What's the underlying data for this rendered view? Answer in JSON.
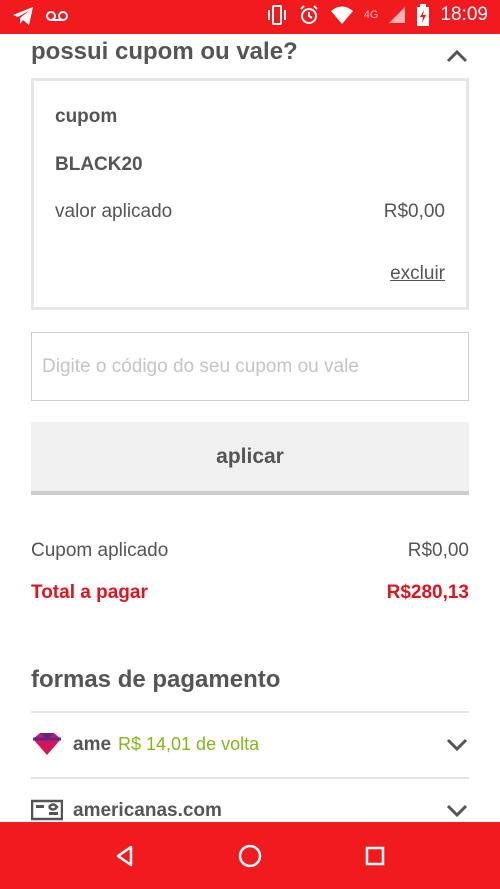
{
  "status_bar": {
    "network": "4G",
    "time": "18:09",
    "icons": [
      "telegram-icon",
      "voicemail-icon",
      "vibrate-icon",
      "alarm-icon",
      "wifi-icon",
      "signal-icon",
      "battery-charging-icon"
    ]
  },
  "coupon": {
    "title": "possui cupom ou vale?",
    "box_label": "cupom",
    "code": "BLACK20",
    "applied_label": "valor aplicado",
    "applied_value": "R$0,00",
    "remove_label": "excluir",
    "input_placeholder": "Digite o código do seu cupom ou vale",
    "input_value": "",
    "apply_label": "aplicar"
  },
  "summary": {
    "coupon_label": "Cupom aplicado",
    "coupon_value": "R$0,00",
    "total_label": "Total a pagar",
    "total_value": "R$280,13"
  },
  "payments": {
    "title": "formas de pagamento",
    "items": [
      {
        "name": "ame",
        "extra": "R$ 14,01 de volta",
        "icon": "ame-heart-icon"
      },
      {
        "name": "americanas.com",
        "extra": "",
        "icon": "gift-card-icon"
      }
    ]
  },
  "nav": {
    "icons": [
      "back-icon",
      "home-icon",
      "recent-apps-icon"
    ]
  },
  "colors": {
    "brand_red": "#f01a1f",
    "total_red": "#e0141e",
    "cashback_green": "#80b918",
    "text_gray": "#555555"
  }
}
